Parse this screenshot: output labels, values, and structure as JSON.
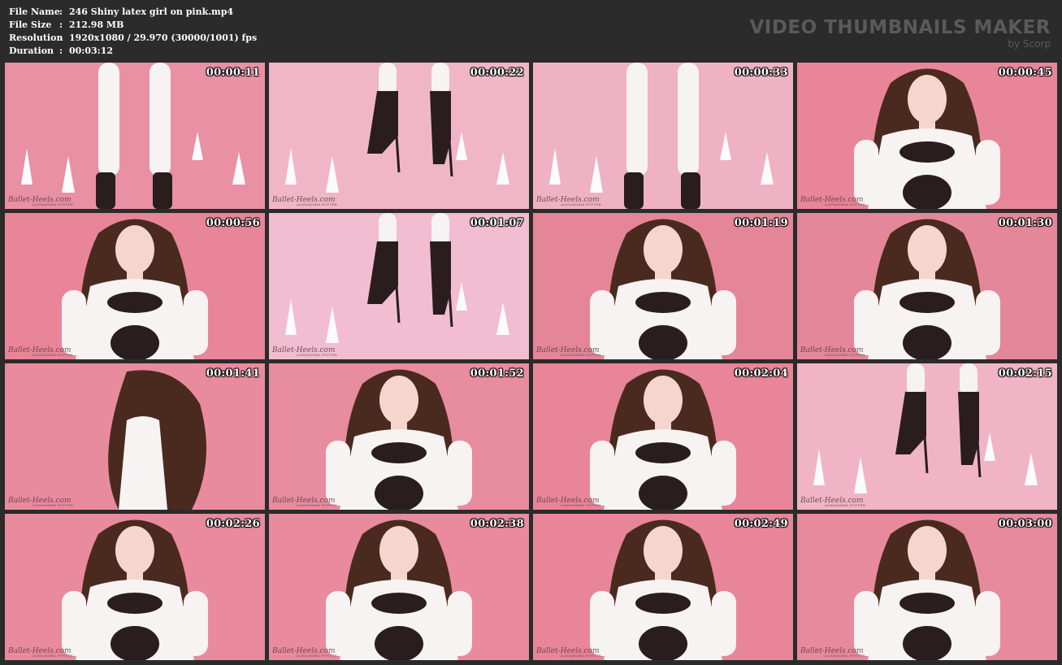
{
  "info": {
    "rows": [
      {
        "label": "File Name",
        "sep": ":",
        "value": "246 Shiny latex girl on pink.mp4"
      },
      {
        "label": "File Size",
        "sep": ":",
        "value": "212.98 MB"
      },
      {
        "label": "Resolution",
        "sep": ":",
        "value": "1920x1080 / 29.970 (30000/1001) fps"
      },
      {
        "label": "Duration",
        "sep": ":",
        "value": "00:03:12"
      }
    ]
  },
  "brand": {
    "title": "VIDEO THUMBNAILS MAKER",
    "subtitle": "by Scorp"
  },
  "watermark": {
    "text": "Ballet-Heels.com",
    "sub": "ALEXANDRA POTTER"
  },
  "thumbnails": [
    {
      "time": "00:00:11",
      "scene": "legs",
      "bg": "#e990a4"
    },
    {
      "time": "00:00:22",
      "scene": "boots",
      "bg": "#f0b6c8"
    },
    {
      "time": "00:00:33",
      "scene": "legs-far",
      "bg": "#efb2c4"
    },
    {
      "time": "00:00:45",
      "scene": "portrait",
      "bg": "#e98599"
    },
    {
      "time": "00:00:56",
      "scene": "pose",
      "bg": "#e98599"
    },
    {
      "time": "00:01:07",
      "scene": "boots",
      "bg": "#f2bdd0"
    },
    {
      "time": "00:01:19",
      "scene": "pose",
      "bg": "#e48698"
    },
    {
      "time": "00:01:30",
      "scene": "pose",
      "bg": "#e4879a"
    },
    {
      "time": "00:01:41",
      "scene": "hair",
      "bg": "#e98b9f"
    },
    {
      "time": "00:01:52",
      "scene": "pose",
      "bg": "#e88c9f"
    },
    {
      "time": "00:02:04",
      "scene": "portrait",
      "bg": "#e88599"
    },
    {
      "time": "00:02:15",
      "scene": "boots",
      "bg": "#f0b4c6"
    },
    {
      "time": "00:02:26",
      "scene": "pose",
      "bg": "#e98a9e"
    },
    {
      "time": "00:02:38",
      "scene": "pose",
      "bg": "#e98a9e"
    },
    {
      "time": "00:02:49",
      "scene": "portrait",
      "bg": "#e98599"
    },
    {
      "time": "00:03:00",
      "scene": "pose",
      "bg": "#e88a9e"
    }
  ]
}
